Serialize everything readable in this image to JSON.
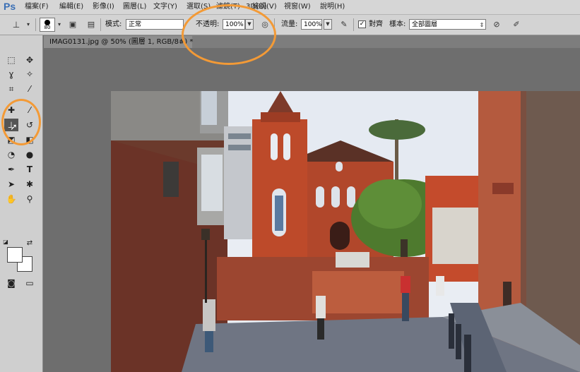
{
  "app": {
    "logo": "Ps"
  },
  "menu": [
    {
      "label": "檔案(F)"
    },
    {
      "label": "編輯(E)"
    },
    {
      "label": "影像(I)"
    },
    {
      "label": "圖層(L)"
    },
    {
      "label": "文字(Y)"
    },
    {
      "label": "選取(S)"
    },
    {
      "label": "濾鏡(T)"
    },
    {
      "label": "3D(D)"
    },
    {
      "label": "檢視(V)"
    },
    {
      "label": "視窗(W)"
    },
    {
      "label": "說明(H)"
    }
  ],
  "options": {
    "brush_size": "80",
    "mode_label": "模式:",
    "mode_value": "正常",
    "opacity_label": "不透明:",
    "opacity_value": "100%",
    "flow_label": "流量:",
    "flow_value": "100%",
    "aligned_label": "對齊",
    "aligned_checked": "✓",
    "sample_label": "樣本:",
    "sample_value": "全部圖層"
  },
  "document": {
    "tab_title": "IMAG0131.jpg @ 50% (圖層 1, RGB/8#) *"
  },
  "colors": {
    "highlight": "#f39a36",
    "foreground": "#ffffff",
    "background": "#ffffff"
  }
}
